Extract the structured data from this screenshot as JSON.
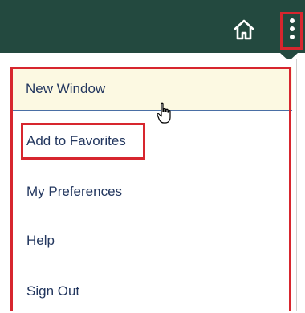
{
  "header": {
    "background": "#23493f",
    "icons": [
      "home-icon",
      "kebab-menu-icon"
    ]
  },
  "menu": {
    "items": [
      {
        "label": "New Window",
        "state": "hover"
      },
      {
        "label": "Add to Favorites",
        "state": "highlighted"
      },
      {
        "label": "My Preferences"
      },
      {
        "label": "Help"
      },
      {
        "label": "Sign Out"
      }
    ]
  },
  "colors": {
    "header": "#23493f",
    "menu_text": "#23375f",
    "hover_background": "#fcf9e2",
    "annotation_red": "#d7262e"
  }
}
